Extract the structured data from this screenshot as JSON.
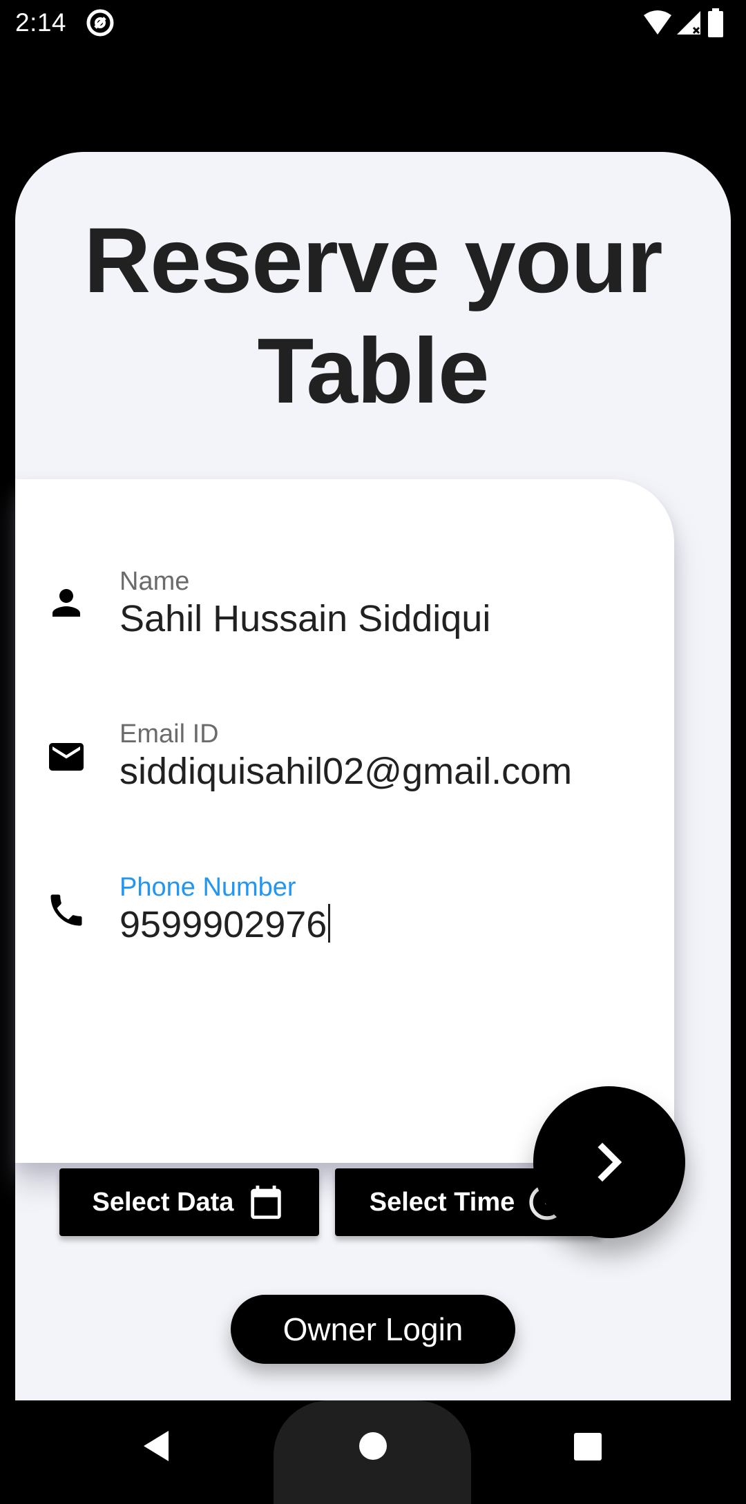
{
  "status_bar": {
    "time": "2:14"
  },
  "page": {
    "title": "Reserve your Table"
  },
  "form": {
    "fields": [
      {
        "label": "Name",
        "value": "Sahil Hussain Siddiqui",
        "icon": "person-icon"
      },
      {
        "label": "Email ID",
        "value": "siddiquisahil02@gmail.com",
        "icon": "mail-icon"
      },
      {
        "label": "Phone Number",
        "value": "9599902976",
        "icon": "phone-icon"
      }
    ],
    "select_date_label": "Select Data",
    "select_time_label": "Select Time"
  },
  "owner_login_label": "Owner Login",
  "colors": {
    "sheet_bg": "#f3f4f9",
    "card_bg": "#ffffff",
    "focused_label": "#2196f3",
    "button_bg": "#000000",
    "title_text": "#212121"
  }
}
